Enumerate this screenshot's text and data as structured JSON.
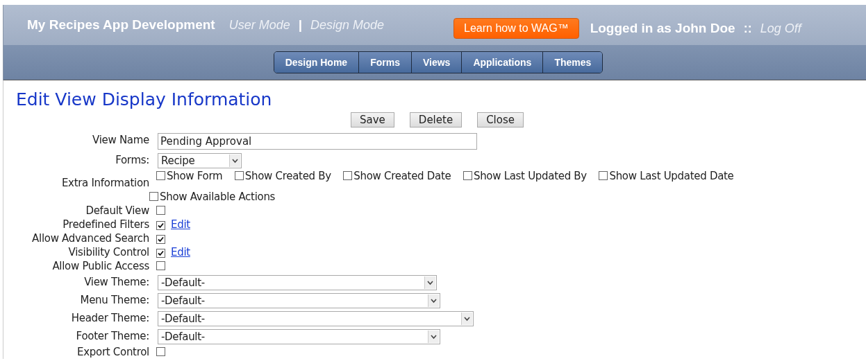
{
  "header": {
    "title": "My Recipes App Development",
    "modes": [
      "User Mode",
      "Design Mode"
    ],
    "separator": "|",
    "wag_button": "Learn how to WAG™",
    "user": "Logged in as John Doe",
    "user_separator": "::",
    "logoff": "Log Off"
  },
  "nav": [
    "Design Home",
    "Forms",
    "Views",
    "Applications",
    "Themes"
  ],
  "page_title": "Edit View Display Information",
  "buttons": [
    "Save",
    "Delete",
    "Close"
  ],
  "fields": [
    {
      "kind": "text",
      "label": "View Name",
      "value": "Pending Approval"
    },
    {
      "kind": "select",
      "label": "Forms:",
      "value": "Recipe"
    },
    {
      "kind": "options",
      "label": "Extra Information",
      "options": [
        {
          "label": "Show Form",
          "checked": false
        },
        {
          "label": "Show Created By",
          "checked": false
        },
        {
          "label": "Show Created Date",
          "checked": false
        },
        {
          "label": "Show Last Updated By",
          "checked": false
        },
        {
          "label": "Show Last Updated Date",
          "checked": false
        },
        {
          "label": "Show Available Actions",
          "checked": false
        }
      ]
    },
    {
      "kind": "checkbox",
      "label": "Default View",
      "checked": false
    },
    {
      "kind": "checkbox",
      "label": "Predefined Filters",
      "checked": true,
      "link": "Edit"
    },
    {
      "kind": "checkbox",
      "label": "Allow Advanced Search",
      "checked": true
    },
    {
      "kind": "checkbox",
      "label": "Visibility Control",
      "checked": true,
      "link": "Edit"
    },
    {
      "kind": "checkbox",
      "label": "Allow Public Access",
      "checked": false
    },
    {
      "kind": "select",
      "label": "View Theme:",
      "value": "-Default-"
    },
    {
      "kind": "select",
      "label": "Menu Theme:",
      "value": "-Default-"
    },
    {
      "kind": "select",
      "label": "Header Theme:",
      "value": "-Default-"
    },
    {
      "kind": "select",
      "label": "Footer Theme:",
      "value": "-Default-"
    },
    {
      "kind": "checkbox",
      "label": "Export Control",
      "checked": false
    }
  ]
}
